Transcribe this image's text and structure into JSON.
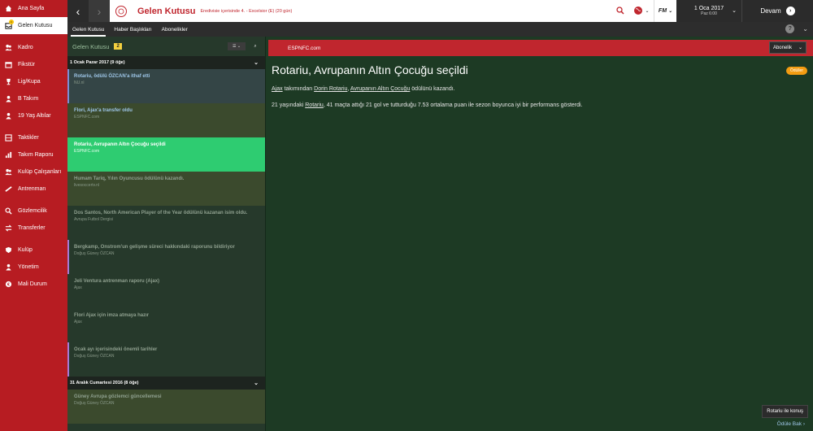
{
  "sidebar": {
    "items": [
      {
        "label": "Ana Sayfa",
        "icon": "home-icon",
        "active": false
      },
      {
        "label": "Gelen Kutusu",
        "icon": "inbox-icon",
        "active": true
      },
      {
        "label": "Kadro",
        "icon": "squad-icon",
        "active": false
      },
      {
        "label": "Fikstür",
        "icon": "calendar-icon",
        "active": false
      },
      {
        "label": "Lig/Kupa",
        "icon": "trophy-icon",
        "active": false
      },
      {
        "label": "B Takım",
        "icon": "b-team-icon",
        "active": false
      },
      {
        "label": "19 Yaş Altılar",
        "icon": "u19-icon",
        "active": false
      },
      {
        "label": "Taktikler",
        "icon": "tactics-icon",
        "active": false
      },
      {
        "label": "Takım Raporu",
        "icon": "report-icon",
        "active": false
      },
      {
        "label": "Kulüp Çalışanları",
        "icon": "staff-icon",
        "active": false
      },
      {
        "label": "Antrenman",
        "icon": "training-icon",
        "active": false
      },
      {
        "label": "Gözlemcilik",
        "icon": "scouting-icon",
        "active": false
      },
      {
        "label": "Transferler",
        "icon": "transfers-icon",
        "active": false
      },
      {
        "label": "Kulüp",
        "icon": "club-icon",
        "active": false
      },
      {
        "label": "Yönetim",
        "icon": "board-icon",
        "active": false
      },
      {
        "label": "Mali Durum",
        "icon": "finances-icon",
        "active": false
      }
    ]
  },
  "topbar": {
    "title": "Gelen Kutusu",
    "subtitle": "Eredivisie içerisinde 4. - Excelsior (E) (20 gün)",
    "date": "1 Oca 2017",
    "time": "Paz 6:00",
    "continue_label": "Devam",
    "fm_label": "FM"
  },
  "tabs": [
    {
      "label": "Gelen Kutusu",
      "active": true
    },
    {
      "label": "Haber Başlıkları",
      "active": false
    },
    {
      "label": "Abonelikler",
      "active": false
    }
  ],
  "inbox": {
    "header_label": "Gelen Kutusu",
    "count": "2",
    "groups": [
      {
        "label": "1 Ocak Pazar 2017 (9 öğe)"
      },
      {
        "label": "31 Aralık Cumartesi 2016 (8 öğe)"
      }
    ],
    "messages": [
      {
        "title": "Rotariu, ödülü ÖZCAN'a ithaf etti",
        "source": "NU.nl"
      },
      {
        "title": "Flori, Ajax'a transfer oldu",
        "source": "ESPNFC.com"
      },
      {
        "title": "Rotariu, Avrupanın Altın Çocuğu seçildi",
        "source": "ESPNFC.com"
      },
      {
        "title": "Humam Tariq, Yılın Oyuncusu ödülünü kazandı.",
        "source": "livesoccertv.nl"
      },
      {
        "title": "Dos Santos, North American Player of the Year ödülünü kazanan isim oldu.",
        "source": "Avrupa Futbol Dergisi"
      },
      {
        "title": "Bergkamp, Onstrom'un gelişme süreci hakkındaki raporunu bildiriyor",
        "source": "Doğuş Güney ÖZCAN"
      },
      {
        "title": "Jeli Ventura antrenman raporu (Ajax)",
        "source": "Ajax"
      },
      {
        "title": "Flori Ajax için imza atmaya hazır",
        "source": "Ajax"
      },
      {
        "title": "Ocak ayı içerisindeki önemli tarihler",
        "source": "Doğuş Güney ÖZCAN"
      },
      {
        "title": "Güney Avrupa gözlemci güncellemesi",
        "source": "Doğuş Güney ÖZCAN"
      }
    ]
  },
  "article": {
    "source": "ESPNFC.com",
    "subscribe_label": "Abonelik",
    "title": "Rotariu, Avrupanın Altın Çocuğu seçildi",
    "badge": "Ödüller",
    "p1_club": "Ajax",
    "p1_mid1": " takımından ",
    "p1_player": "Dorin Rotariu",
    "p1_mid2": ", ",
    "p1_award": "Avrupanın Altın Çocuğu",
    "p1_end": " ödülünü kazandı.",
    "p2_start": "21 yaşındaki ",
    "p2_player": "Rotariu",
    "p2_end": ", 41 maçta attığı 21 gol ve tutturduğu 7.53 ortalama puan ile sezon boyunca iyi bir performans gösterdi.",
    "talk_label": "Rotariu ile konuş",
    "award_link": "Ödüle Bak"
  },
  "colors": {
    "sidebar": "#b71c22",
    "accent": "#c0262e",
    "selected": "#2ecc71"
  }
}
